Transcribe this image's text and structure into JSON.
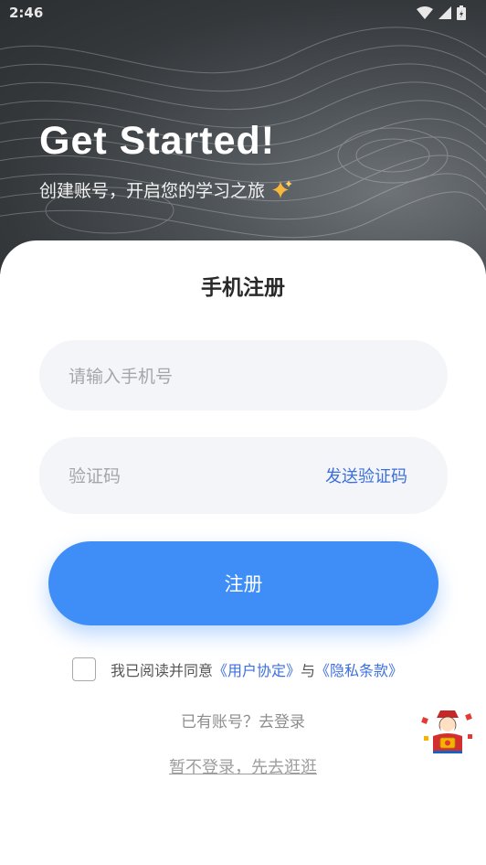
{
  "status_bar": {
    "time": "2:46"
  },
  "hero": {
    "title": "Get Started!",
    "subtitle": "创建账号，开启您的学习之旅"
  },
  "form": {
    "title": "手机注册",
    "phone_placeholder": "请输入手机号",
    "code_placeholder": "验证码",
    "send_code_label": "发送验证码",
    "submit_label": "注册"
  },
  "agreement": {
    "prefix": "我已阅读并同意",
    "user_agreement": "《用户协定》",
    "connector": "与",
    "privacy_policy": "《隐私条款》",
    "checked": false
  },
  "footer": {
    "login_prompt": "已有账号？去登录",
    "browse_link": "暂不登录，先去逛逛"
  },
  "colors": {
    "accent": "#3f8ef8",
    "link": "#3d6fdc",
    "field_bg": "#f4f5f9"
  },
  "icons": {
    "wifi": "wifi-icon",
    "signal": "signal-icon",
    "battery": "battery-icon",
    "sparkle": "sparkle-icon",
    "mascot": "fortune-mascot-icon"
  }
}
